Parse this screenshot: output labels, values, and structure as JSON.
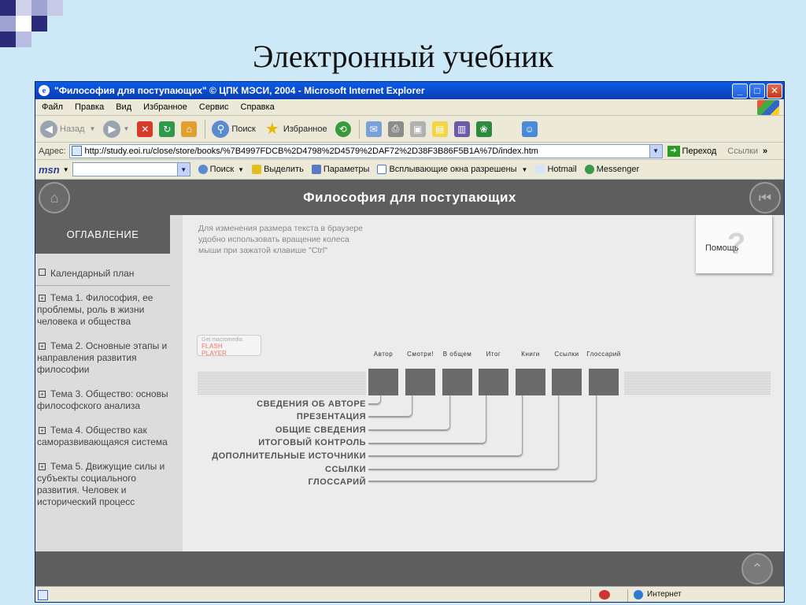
{
  "slide": {
    "title": "Электронный учебник"
  },
  "window": {
    "title": "\"Философия для поступающих\" © ЦПК МЭСИ, 2004 - Microsoft Internet Explorer",
    "min": "_",
    "max": "□",
    "close": "✕"
  },
  "menu": [
    "Файл",
    "Правка",
    "Вид",
    "Избранное",
    "Сервис",
    "Справка"
  ],
  "toolbar": {
    "back": "Назад",
    "search": "Поиск",
    "favorites": "Избранное"
  },
  "address": {
    "label": "Адрес:",
    "url": "http://study.eoi.ru/close/store/books/%7B4997FDCB%2D4798%2D4579%2DAF72%2D38F3B86F5B1A%7D/index.htm",
    "go": "Переход",
    "links": "Ссылки"
  },
  "msn": {
    "logo": "msn",
    "search": "Поиск",
    "highlight": "Выделить",
    "params": "Параметры",
    "popups": "Всплывающие окна разрешены",
    "hotmail": "Hotmail",
    "messenger": "Messenger"
  },
  "page": {
    "title": "Философия для поступающих",
    "toc_header": "ОГЛАВЛЕНИЕ",
    "toc": [
      "Календарный план",
      "Тема 1. Философия, ее проблемы, роль в жизни человека и общества",
      "Тема 2. Основные этапы и направления развития философии",
      "Тема 3. Общество: основы философского анализа",
      "Тема 4. Общество как саморазвивающаяся система",
      "Тема 5. Движущие силы и субъекты социального развития. Человек и исторический процесс"
    ],
    "hint_lines": [
      "Для изменения размера текста в браузере",
      "удобно использовать вращение колеса",
      "мыши при зажатой клавише \"Ctrl\""
    ],
    "help": "Помощь",
    "flash_badge": {
      "line1": "Get macromedia",
      "line2": "FLASH",
      "line3": "PLAYER"
    },
    "nav_columns": [
      "Автор",
      "Смотри!",
      "В общем",
      "Итог",
      "Книги",
      "Ссылки",
      "Глоссарий"
    ],
    "nav_labels": [
      "СВЕДЕНИЯ ОБ АВТОРЕ",
      "ПРЕЗЕНТАЦИЯ",
      "ОБЩИЕ СВЕДЕНИЯ",
      "ИТОГОВЫЙ КОНТРОЛЬ",
      "ДОПОЛНИТЕЛЬНЫЕ ИСТОЧНИКИ",
      "ССЫЛКИ",
      "ГЛОССАРИЙ"
    ]
  },
  "status": {
    "zone": "Интернет"
  },
  "colors": {
    "title_blue": "#0b48c9",
    "page_gray": "#5e5e5e",
    "slide_bg": "#cde8f6"
  }
}
